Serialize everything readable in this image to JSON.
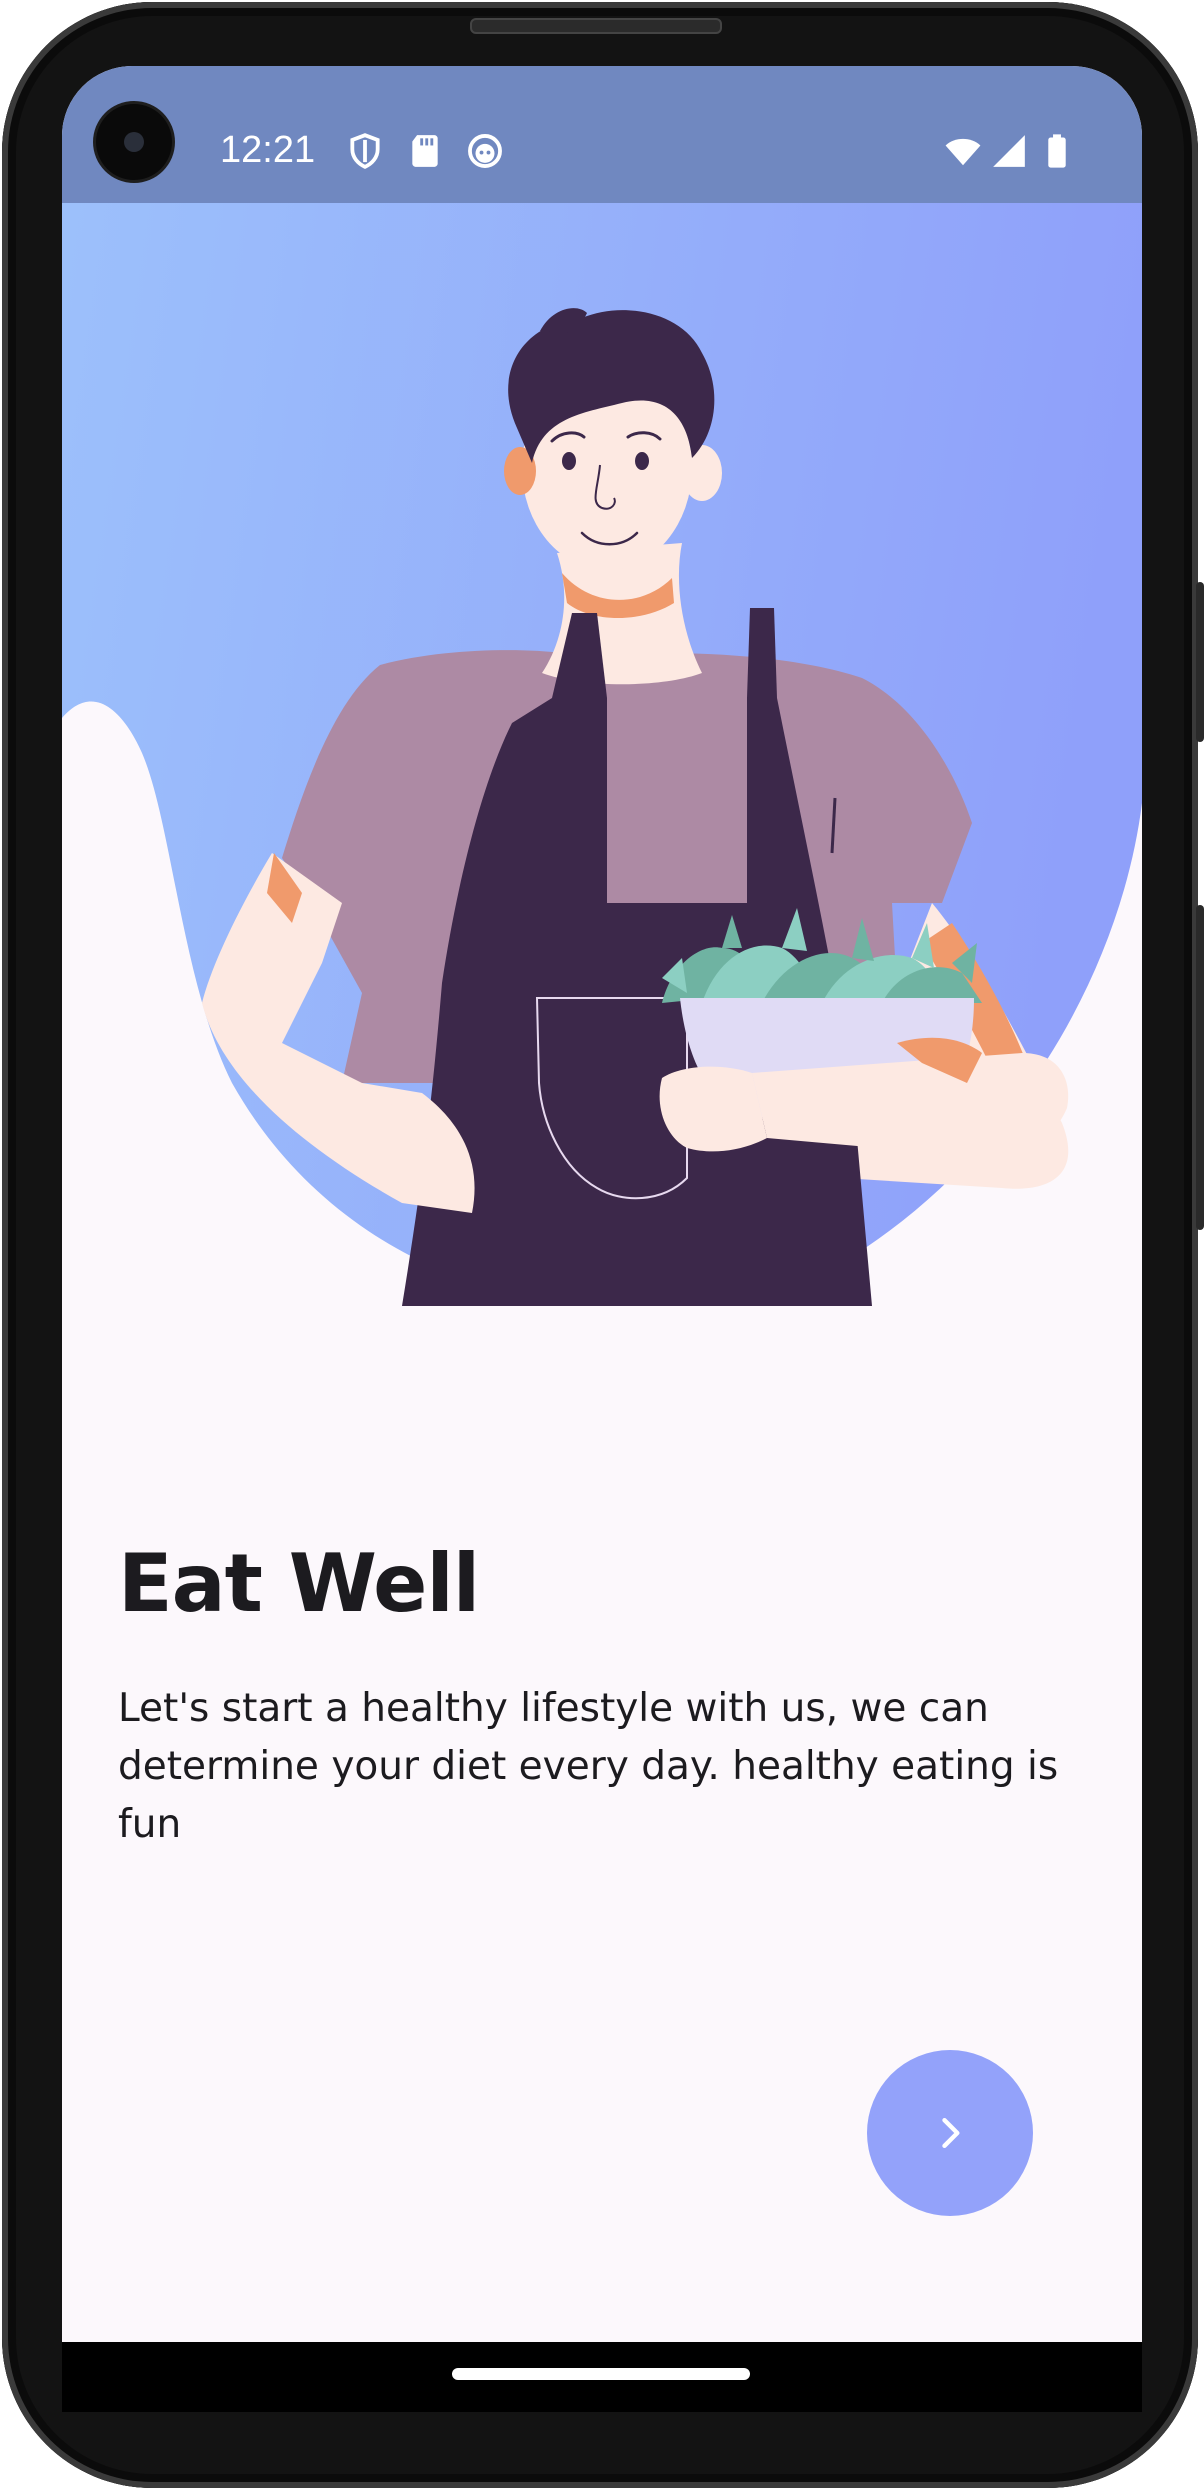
{
  "status_bar": {
    "time": "12:21",
    "icons": [
      "vpn-shield-icon",
      "sd-card-icon",
      "app-notification-icon",
      "wifi-icon",
      "cell-signal-icon",
      "battery-icon"
    ]
  },
  "onboarding": {
    "illustration": "man-in-apron-holding-salad-bowl",
    "title": "Eat Well",
    "description": "Let's start a healthy lifestyle with us, we can determine your diet every day. healthy eating is fun",
    "next_button_icon": "chevron-right-icon"
  },
  "colors": {
    "status_bar": "#7088c0",
    "gradient_start": "#9cc0fb",
    "gradient_end": "#8fa0fa",
    "background": "#fcf8fc",
    "accent": "#93a2fa",
    "text": "#1c1b1f"
  }
}
